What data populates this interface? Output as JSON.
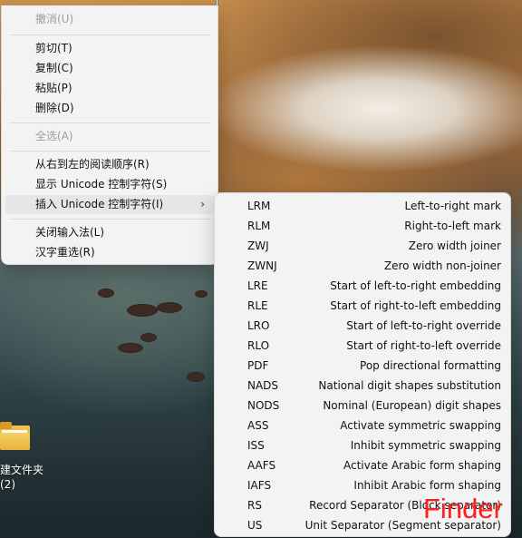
{
  "context_menu": {
    "items": [
      {
        "label": "撤消(U)",
        "disabled": true
      },
      {
        "label": "剪切(T)",
        "disabled": false
      },
      {
        "label": "复制(C)",
        "disabled": false
      },
      {
        "label": "粘贴(P)",
        "disabled": false
      },
      {
        "label": "删除(D)",
        "disabled": false
      },
      {
        "label": "全选(A)",
        "disabled": true
      },
      {
        "label": "从右到左的阅读顺序(R)",
        "disabled": false
      },
      {
        "label": "显示 Unicode 控制字符(S)",
        "disabled": false
      },
      {
        "label": "插入 Unicode 控制字符(I)",
        "disabled": false,
        "submenu": true,
        "highlighted": true
      },
      {
        "label": "关闭输入法(L)",
        "disabled": false
      },
      {
        "label": "汉字重选(R)",
        "disabled": false
      }
    ],
    "chevron_icon": "chevron-right-icon",
    "chevron_glyph": "›"
  },
  "submenu": {
    "rows": [
      {
        "abbr": "LRM",
        "desc": "Left-to-right mark"
      },
      {
        "abbr": "RLM",
        "desc": "Right-to-left mark"
      },
      {
        "abbr": "ZWJ",
        "desc": "Zero width joiner"
      },
      {
        "abbr": "ZWNJ",
        "desc": "Zero width non-joiner"
      },
      {
        "abbr": "LRE",
        "desc": "Start of left-to-right embedding"
      },
      {
        "abbr": "RLE",
        "desc": "Start of right-to-left embedding"
      },
      {
        "abbr": "LRO",
        "desc": "Start of left-to-right override"
      },
      {
        "abbr": "RLO",
        "desc": "Start of right-to-left override"
      },
      {
        "abbr": "PDF",
        "desc": "Pop directional formatting"
      },
      {
        "abbr": "NADS",
        "desc": "National digit shapes substitution"
      },
      {
        "abbr": "NODS",
        "desc": "Nominal (European) digit shapes"
      },
      {
        "abbr": "ASS",
        "desc": "Activate symmetric swapping"
      },
      {
        "abbr": "ISS",
        "desc": "Inhibit symmetric swapping"
      },
      {
        "abbr": "AAFS",
        "desc": "Activate Arabic form shaping"
      },
      {
        "abbr": "IAFS",
        "desc": "Inhibit Arabic form shaping"
      },
      {
        "abbr": "RS",
        "desc": "Record Separator (Block separator)"
      },
      {
        "abbr": "US",
        "desc": "Unit Separator (Segment separator)"
      }
    ]
  },
  "desktop": {
    "icon_label": "建文件夹\n(2)",
    "icon_name": "folder-icon"
  },
  "watermark": {
    "text": "Finder",
    "color": "#ff1f1f"
  },
  "colors": {
    "menu_bg": "#f3f3f3",
    "highlight": "#e6e6e6",
    "disabled_text": "#9c9c9c"
  }
}
